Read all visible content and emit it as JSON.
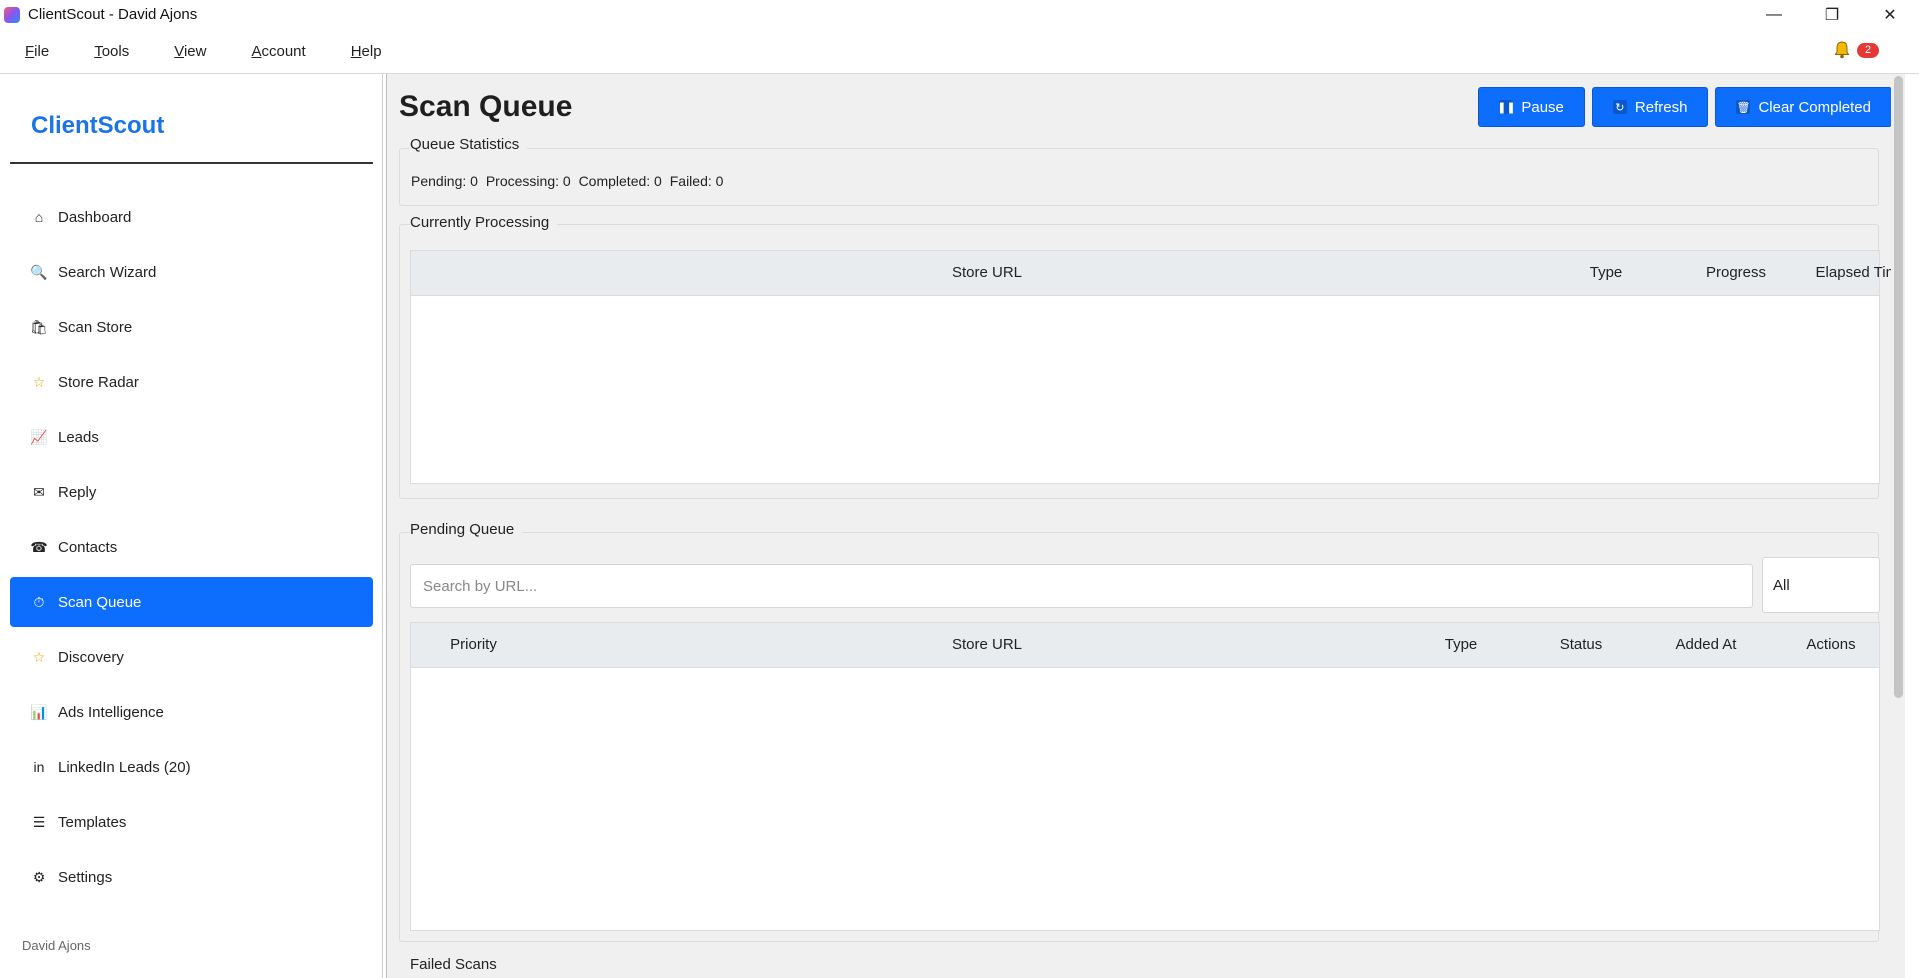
{
  "window": {
    "title": "ClientScout - David Ajons",
    "controls": {
      "minimize": "—",
      "restore": "❐",
      "close": "✕"
    }
  },
  "menubar": {
    "items": [
      {
        "label": "File",
        "mnemonic": "F",
        "rest": "ile"
      },
      {
        "label": "Tools",
        "mnemonic": "T",
        "rest": "ools"
      },
      {
        "label": "View",
        "mnemonic": "V",
        "rest": "iew"
      },
      {
        "label": "Account",
        "mnemonic": "A",
        "rest": "ccount"
      },
      {
        "label": "Help",
        "mnemonic": "H",
        "rest": "elp"
      }
    ],
    "notification_count": "2"
  },
  "sidebar": {
    "brand": "ClientScout",
    "items": [
      {
        "label": "Dashboard",
        "icon": "⌂"
      },
      {
        "label": "Search Wizard",
        "icon": "🔍"
      },
      {
        "label": "Scan Store",
        "icon": "🛍"
      },
      {
        "label": "Store Radar",
        "icon": "☆"
      },
      {
        "label": "Leads",
        "icon": "📈"
      },
      {
        "label": "Reply",
        "icon": "✉"
      },
      {
        "label": "Contacts",
        "icon": "☎"
      },
      {
        "label": "Scan Queue",
        "icon": "⏱"
      },
      {
        "label": "Discovery",
        "icon": "☆"
      },
      {
        "label": "Ads Intelligence",
        "icon": "📊"
      },
      {
        "label": "LinkedIn Leads (20)",
        "icon": "in"
      },
      {
        "label": "Templates",
        "icon": "☰"
      },
      {
        "label": "Settings",
        "icon": "⚙"
      }
    ],
    "active_index": 7,
    "user": "David Ajons"
  },
  "main": {
    "title": "Scan Queue",
    "buttons": {
      "pause": "Pause",
      "refresh": "Refresh",
      "clear": "Clear Completed"
    },
    "queue_statistics": {
      "label": "Queue Statistics",
      "pending": "Pending: 0",
      "processing": "Processing: 0",
      "completed": "Completed: 0",
      "failed": "Failed: 0"
    },
    "currently_processing": {
      "label": "Currently Processing",
      "columns": [
        "Store URL",
        "Type",
        "Progress",
        "Elapsed Time"
      ]
    },
    "pending_queue": {
      "label": "Pending Queue",
      "search_placeholder": "Search by URL...",
      "filter_value": "All",
      "columns": [
        "Priority",
        "Store URL",
        "Type",
        "Status",
        "Added At",
        "Actions"
      ]
    },
    "failed_scans": {
      "label": "Failed Scans"
    }
  }
}
